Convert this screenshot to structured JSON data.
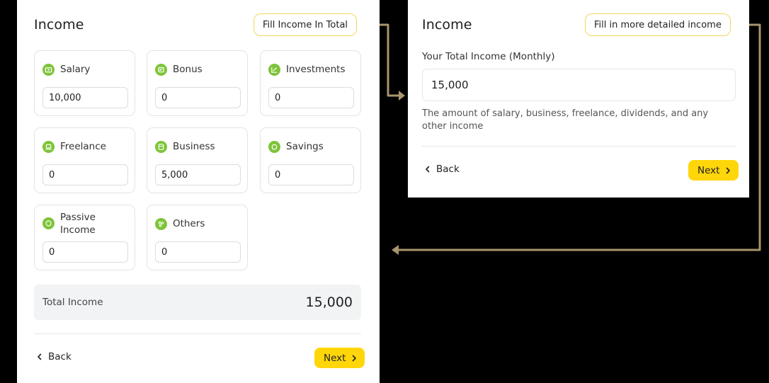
{
  "left_panel": {
    "title": "Income",
    "mode_button": "Fill Income In Total",
    "cards": [
      {
        "label": "Salary",
        "icon": "wallet-icon",
        "value": "10,000"
      },
      {
        "label": "Bonus",
        "icon": "gift-card-icon",
        "value": "0"
      },
      {
        "label": "Investments",
        "icon": "trend-chart-icon",
        "value": "0"
      },
      {
        "label": "Freelance",
        "icon": "laptop-icon",
        "value": "0"
      },
      {
        "label": "Business",
        "icon": "store-icon",
        "value": "5,000"
      },
      {
        "label": "Savings",
        "icon": "piggy-bank-icon",
        "value": "0"
      },
      {
        "label": "Passive Income",
        "icon": "coin-icon",
        "value": "0"
      },
      {
        "label": "Others",
        "icon": "dots-cluster-icon",
        "value": "0"
      }
    ],
    "total": {
      "label": "Total Income",
      "value": "15,000"
    },
    "back_label": "Back",
    "next_label": "Next"
  },
  "right_panel": {
    "title": "Income",
    "mode_button": "Fill in more detailed income",
    "field_label": "Your Total Income (Monthly)",
    "field_value": "15,000",
    "hint": "The amount of salary, business, freelance, dividends, and any other income",
    "back_label": "Back",
    "next_label": "Next"
  },
  "colors": {
    "accent_yellow": "#ffd60a",
    "pill_border": "#f3d75a",
    "icon_green": "#7dc438",
    "connector": "#a8956b"
  }
}
